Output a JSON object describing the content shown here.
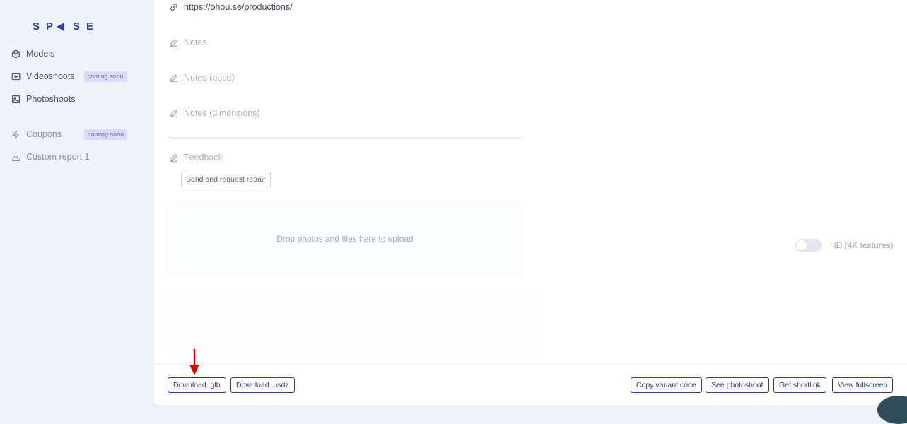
{
  "logo": {
    "letters": [
      "S",
      "P",
      "S",
      "E"
    ]
  },
  "sidebar": {
    "items": [
      {
        "label": "Models",
        "icon": "cube-icon"
      },
      {
        "label": "Videoshoots",
        "icon": "video-icon",
        "badge": "coming soon"
      },
      {
        "label": "Photoshoots",
        "icon": "image-icon"
      },
      {
        "label": "Coupons",
        "icon": "bolt-icon",
        "badge": "coming soon"
      },
      {
        "label": "Custom report 1",
        "icon": "download-icon"
      }
    ]
  },
  "main": {
    "link_url": "https://ohou.se/productions/",
    "notes_placeholder": "Notes",
    "notes_pose_placeholder": "Notes (pose)",
    "notes_dimensions_placeholder": "Notes (dimensions)",
    "feedback_placeholder": "Feedback",
    "send_repair_label": "Send and request repair",
    "dropzone_text": "Drop photos and files here to upload",
    "hd_toggle_label": "HD (4K textures)",
    "hd_toggle_on": false
  },
  "footer": {
    "download_glb": "Download .glb",
    "download_usdz": "Download .usdz",
    "copy_variant_code": "Copy variant code",
    "see_photoshoot": "See photoshoot",
    "get_shortlink": "Get shortlink",
    "view_fullscreen": "View fullscreen"
  },
  "colors": {
    "brand": "#2a3fa8",
    "button_border": "#2f3d7a",
    "annotation_arrow": "#e00000"
  }
}
